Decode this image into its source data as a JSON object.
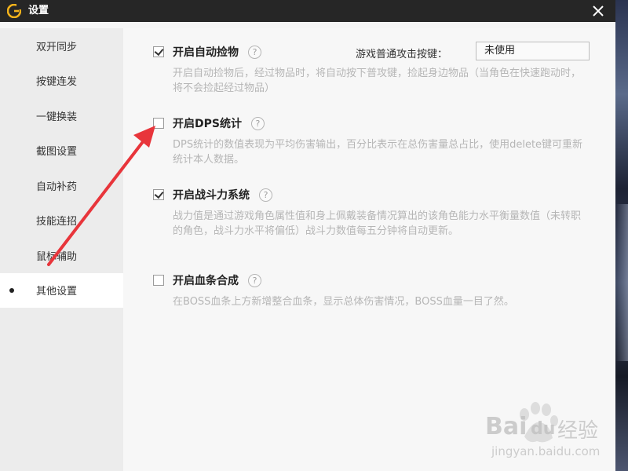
{
  "window": {
    "title": "设置",
    "close_glyph": "✕",
    "logo_icon": "game-logo-icon"
  },
  "sidebar": {
    "items": [
      {
        "label": "双开同步"
      },
      {
        "label": "按键连发"
      },
      {
        "label": "一键换装"
      },
      {
        "label": "截图设置"
      },
      {
        "label": "自动补药"
      },
      {
        "label": "技能连招"
      },
      {
        "label": "鼠标辅助"
      },
      {
        "label": "其他设置",
        "active": true
      }
    ]
  },
  "options": {
    "auto_pickup": {
      "title": "开启自动捡物",
      "checked": true,
      "help": "?",
      "desc": "开启自动捡物后，经过物品时，将自动按下普攻键，捡起身边物品（当角色在快速跑动时，将不会捡起经过物品）",
      "hotkey_label": "游戏普通攻击按键：",
      "hotkey_value": "未使用"
    },
    "dps_stats": {
      "title": "开启DPS统计",
      "checked": false,
      "help": "?",
      "desc": "DPS统计的数值表现为平均伤害输出，百分比表示在总伤害量总占比，使用delete键可重新统计本人数据。"
    },
    "combat_power": {
      "title": "开启战斗力系统",
      "checked": true,
      "help": "?",
      "desc": "战力值是通过游戏角色属性值和身上佩戴装备情况算出的该角色能力水平衡量数值（未转职的角色，战斗力水平将偏低）战斗力数值每五分钟将自动更新。"
    },
    "hp_bar_merge": {
      "title": "开启血条合成",
      "checked": false,
      "help": "?",
      "desc": "在BOSS血条上方新增整合血条，显示总体伤害情况，BOSS血量一目了然。"
    }
  },
  "watermark": {
    "brand": "Bai",
    "brand_suffix": "du",
    "cn": "经验",
    "url": "jingyan.baidu.com"
  },
  "colors": {
    "titlebar": "#262626",
    "sidebar": "#ececec",
    "content": "#f7f7f7",
    "annotation_arrow": "#e8353b",
    "logo": "#f2b21b"
  }
}
